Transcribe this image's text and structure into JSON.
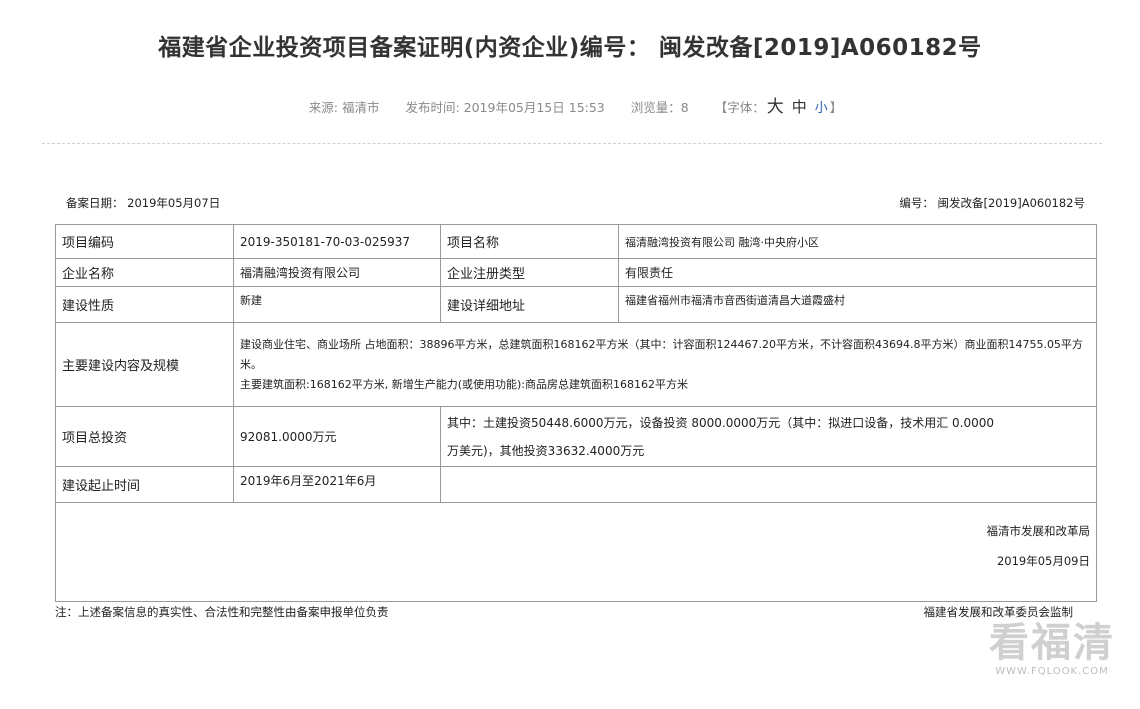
{
  "header": {
    "title": "福建省企业投资项目备案证明(内资企业)编号： 闽发改备[2019]A060182号",
    "source": "来源: 福清市",
    "publish_time": "发布时间: 2019年05月15日 15:53",
    "views": "浏览量：8",
    "font_size_prefix": "【字体：",
    "font_large": "大",
    "font_medium": "中",
    "font_small": "小",
    "font_size_suffix": "】"
  },
  "record": {
    "date": "备案日期： 2019年05月07日",
    "number": "编号： 闽发改备[2019]A060182号",
    "rows": {
      "project_code_label": "项目编码",
      "project_code": "2019-350181-70-03-025937",
      "project_name_label": "项目名称",
      "project_name": "福清融湾投资有限公司 融湾·中央府小区",
      "company_label": "企业名称",
      "company": "福清融湾投资有限公司",
      "reg_type_label": "企业注册类型",
      "reg_type": "有限责任",
      "nature_label": "建设性质",
      "nature": "新建",
      "address_label": "建设详细地址",
      "address": "福建省福州市福清市音西街道清昌大道霞盛村",
      "scope_label": "主要建设内容及规模",
      "scope_line1": "建设商业住宅、商业场所 占地面积：38896平方米，总建筑面积168162平方米（其中：计容面积124467.20平方米，不计容面积43694.8平方米）商业面积14755.05平方",
      "scope_line2": "米。",
      "scope_line3": "主要建筑面积:168162平方米, 新增生产能力(或使用功能):商品房总建筑面积168162平方米",
      "investment_label": "项目总投资",
      "investment": "92081.0000万元",
      "investment_detail1": "其中：土建投资50448.6000万元，设备投资 8000.0000万元（其中：拟进口设备，技术用汇 0.0000",
      "investment_detail2": "万美元)，其他投资33632.4000万元",
      "period_label": "建设起止时间",
      "period": "2019年6月至2021年6月"
    },
    "sign_office": "福清市发展和改革局",
    "sign_date": "2019年05月09日"
  },
  "footer": {
    "note": "注：上述备案信息的真实性、合法性和完整性由备案申报单位负责",
    "supervise": "福建省发展和改革委员会监制"
  },
  "watermark": {
    "brand": "看福清",
    "url": "WWW.FQLOOK.COM"
  }
}
